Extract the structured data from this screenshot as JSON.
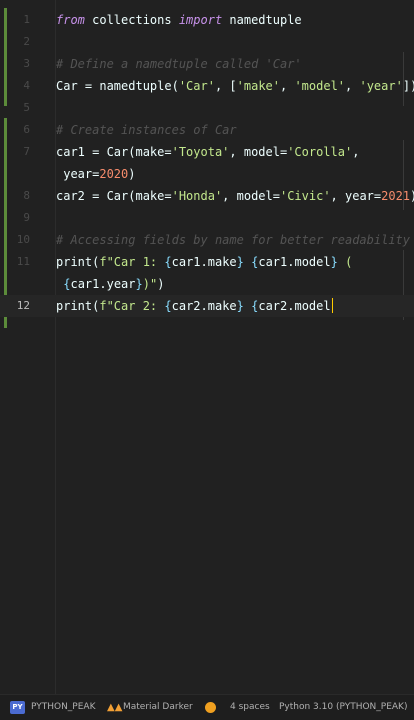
{
  "editor": {
    "current_line": 12,
    "lines": [
      {
        "num": "1",
        "tokens": [
          {
            "c": "kw",
            "t": "from"
          },
          {
            "c": "pl",
            "t": " collections "
          },
          {
            "c": "kw",
            "t": "import"
          },
          {
            "c": "pl",
            "t": " namedtuple"
          }
        ]
      },
      {
        "num": "2",
        "tokens": []
      },
      {
        "num": "3",
        "tokens": [
          {
            "c": "cm",
            "t": "# Define a namedtuple called 'Car'"
          }
        ]
      },
      {
        "num": "4",
        "tokens": [
          {
            "c": "pl",
            "t": "Car = namedtuple("
          },
          {
            "c": "st",
            "t": "'Car'"
          },
          {
            "c": "pl",
            "t": ", ["
          },
          {
            "c": "st",
            "t": "'make'"
          },
          {
            "c": "pl",
            "t": ", "
          },
          {
            "c": "st",
            "t": "'model'"
          },
          {
            "c": "pl",
            "t": ", "
          },
          {
            "c": "st",
            "t": "'year'"
          },
          {
            "c": "pl",
            "t": "])"
          }
        ]
      },
      {
        "num": "5",
        "tokens": []
      },
      {
        "num": "6",
        "tokens": [
          {
            "c": "cm",
            "t": "# Create instances of Car"
          }
        ]
      },
      {
        "num": "7",
        "tokens": [
          {
            "c": "pl",
            "t": "car1 = Car(make="
          },
          {
            "c": "st",
            "t": "'Toyota'"
          },
          {
            "c": "pl",
            "t": ", model="
          },
          {
            "c": "st",
            "t": "'Corolla'"
          },
          {
            "c": "pl",
            "t": ","
          }
        ],
        "wrap": [
          {
            "c": "pl",
            "t": " year="
          },
          {
            "c": "nm",
            "t": "2020"
          },
          {
            "c": "pl",
            "t": ")"
          }
        ]
      },
      {
        "num": "8",
        "tokens": [
          {
            "c": "pl",
            "t": "car2 = Car(make="
          },
          {
            "c": "st",
            "t": "'Honda'"
          },
          {
            "c": "pl",
            "t": ", model="
          },
          {
            "c": "st",
            "t": "'Civic'"
          },
          {
            "c": "pl",
            "t": ", year="
          },
          {
            "c": "nm",
            "t": "2021"
          },
          {
            "c": "pl",
            "t": ")"
          }
        ]
      },
      {
        "num": "9",
        "tokens": []
      },
      {
        "num": "10",
        "tokens": [
          {
            "c": "cm",
            "t": "# Accessing fields by name for better readability"
          }
        ]
      },
      {
        "num": "11",
        "tokens": [
          {
            "c": "pl",
            "t": "print("
          },
          {
            "c": "st",
            "t": "f\"Car 1: "
          },
          {
            "c": "op",
            "t": "{"
          },
          {
            "c": "pl",
            "t": "car1.make"
          },
          {
            "c": "op",
            "t": "}"
          },
          {
            "c": "st",
            "t": " "
          },
          {
            "c": "op",
            "t": "{"
          },
          {
            "c": "pl",
            "t": "car1.model"
          },
          {
            "c": "op",
            "t": "}"
          },
          {
            "c": "st",
            "t": " ("
          }
        ],
        "wrap": [
          {
            "c": "st",
            "t": " "
          },
          {
            "c": "op",
            "t": "{"
          },
          {
            "c": "pl",
            "t": "car1.year"
          },
          {
            "c": "op",
            "t": "}"
          },
          {
            "c": "st",
            "t": ")\""
          },
          {
            "c": "pl",
            "t": ")"
          }
        ]
      },
      {
        "num": "12",
        "tokens": [
          {
            "c": "pl",
            "t": "print("
          },
          {
            "c": "st",
            "t": "f\"Car 2: "
          },
          {
            "c": "op",
            "t": "{"
          },
          {
            "c": "pl",
            "t": "car2.make"
          },
          {
            "c": "op",
            "t": "}"
          },
          {
            "c": "st",
            "t": " "
          },
          {
            "c": "op",
            "t": "{"
          },
          {
            "c": "pl",
            "t": "car2.model"
          }
        ]
      }
    ]
  },
  "statusbar": {
    "project_badge": "PY",
    "project_name": "PYTHON_PEAK",
    "theme_icon": "material-theme-icon",
    "theme_name": "Material Darker",
    "status_dot_color": "#f0a020",
    "indent": "4 spaces",
    "interpreter": "Python 3.10 (PYTHON_PEAK)"
  },
  "colors": {
    "background": "#212121",
    "keyword": "#c792ea",
    "comment": "#545454",
    "string": "#c3e88d",
    "number": "#f78c6c",
    "brace": "#89ddff",
    "caret": "#ffcc00",
    "vcs_added": "#5c8c3a"
  }
}
